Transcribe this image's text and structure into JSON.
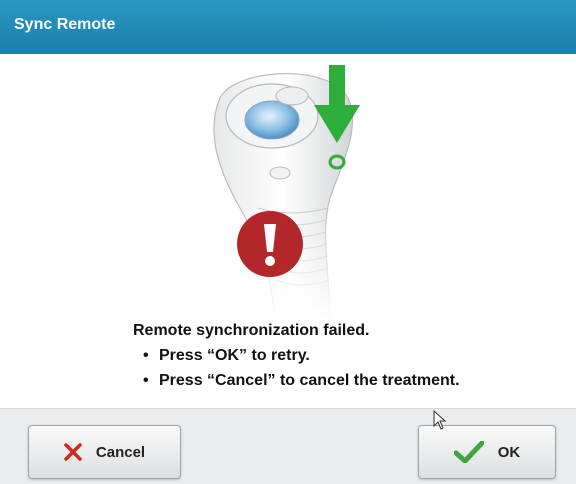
{
  "window": {
    "title": "Sync Remote"
  },
  "message": {
    "headline": "Remote synchronization failed.",
    "bullets": [
      "Press “OK” to retry.",
      "Press “Cancel” to cancel the treatment."
    ],
    "bullet_glyph": "•"
  },
  "buttons": {
    "cancel_label": "Cancel",
    "ok_label": "OK"
  },
  "colors": {
    "titlebar": "#1f8bbd",
    "alert": "#b3262a",
    "arrow": "#2eae3a",
    "cancel_x": "#cc2a22",
    "ok_check": "#3fa63a"
  },
  "icons": {
    "alert": "exclamation-circle",
    "arrow": "down-arrow",
    "cancel": "x-mark",
    "ok": "check-mark"
  }
}
